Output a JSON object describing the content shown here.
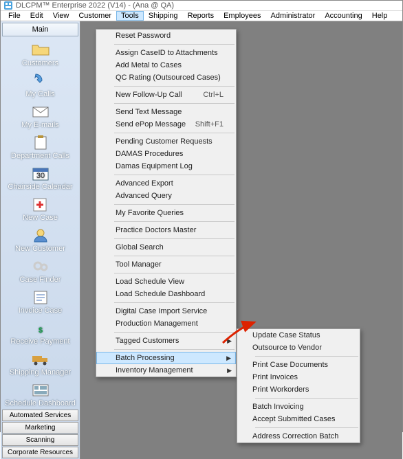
{
  "title": "DLCPM™ Enterprise 2022 (V14) - (Ana @ QA)",
  "menubar": [
    "File",
    "Edit",
    "View",
    "Customer",
    "Tools",
    "Shipping",
    "Reports",
    "Employees",
    "Administrator",
    "Accounting",
    "Help"
  ],
  "menubar_active_index": 4,
  "sidebar": {
    "header": "Main",
    "items": [
      {
        "label": "Customers",
        "icon": "folder"
      },
      {
        "label": "My Calls",
        "icon": "phone"
      },
      {
        "label": "My E-mails",
        "icon": "mail"
      },
      {
        "label": "Department Calls",
        "icon": "clipboard"
      },
      {
        "label": "Chairside Calendar",
        "icon": "calendar",
        "badge": "30"
      },
      {
        "label": "New Case",
        "icon": "plus"
      },
      {
        "label": "New Customer",
        "icon": "user"
      },
      {
        "label": "Case Finder",
        "icon": "gears"
      },
      {
        "label": "Invoice Case",
        "icon": "invoice"
      },
      {
        "label": "Receive Payment",
        "icon": "dollar"
      },
      {
        "label": "Shipping Manager",
        "icon": "truck"
      },
      {
        "label": "Schedule Dashboard",
        "icon": "dashboard"
      }
    ],
    "bottom_buttons": [
      "Automated Services",
      "Marketing",
      "Scanning",
      "Corporate Resources"
    ]
  },
  "tools_menu": {
    "groups": [
      [
        {
          "label": "Reset Password"
        }
      ],
      [
        {
          "label": "Assign CaseID to Attachments"
        },
        {
          "label": "Add Metal to Cases"
        },
        {
          "label": "QC Rating (Outsourced Cases)"
        }
      ],
      [
        {
          "label": "New Follow-Up Call",
          "shortcut": "Ctrl+L"
        }
      ],
      [
        {
          "label": "Send Text Message"
        },
        {
          "label": "Send ePop Message",
          "shortcut": "Shift+F1"
        }
      ],
      [
        {
          "label": "Pending Customer Requests"
        },
        {
          "label": "DAMAS Procedures"
        },
        {
          "label": "Damas Equipment Log"
        }
      ],
      [
        {
          "label": "Advanced Export"
        },
        {
          "label": "Advanced Query"
        }
      ],
      [
        {
          "label": "My Favorite Queries"
        }
      ],
      [
        {
          "label": "Practice Doctors Master"
        }
      ],
      [
        {
          "label": "Global Search"
        }
      ],
      [
        {
          "label": "Tool Manager"
        }
      ],
      [
        {
          "label": "Load Schedule View"
        },
        {
          "label": "Load Schedule Dashboard"
        }
      ],
      [
        {
          "label": "Digital Case Import Service"
        },
        {
          "label": "Production Management"
        }
      ],
      [
        {
          "label": "Tagged Customers",
          "submenu": true
        }
      ],
      [
        {
          "label": "Batch Processing",
          "submenu": true,
          "highlight": true
        },
        {
          "label": "Inventory Management",
          "submenu": true
        }
      ]
    ]
  },
  "batch_submenu": {
    "groups": [
      [
        {
          "label": "Update Case Status"
        },
        {
          "label": "Outsource to Vendor"
        }
      ],
      [
        {
          "label": "Print Case Documents"
        },
        {
          "label": "Print Invoices"
        },
        {
          "label": "Print Workorders"
        }
      ],
      [
        {
          "label": "Batch Invoicing"
        },
        {
          "label": "Accept Submitted Cases"
        }
      ],
      [
        {
          "label": "Address Correction Batch"
        }
      ]
    ]
  }
}
